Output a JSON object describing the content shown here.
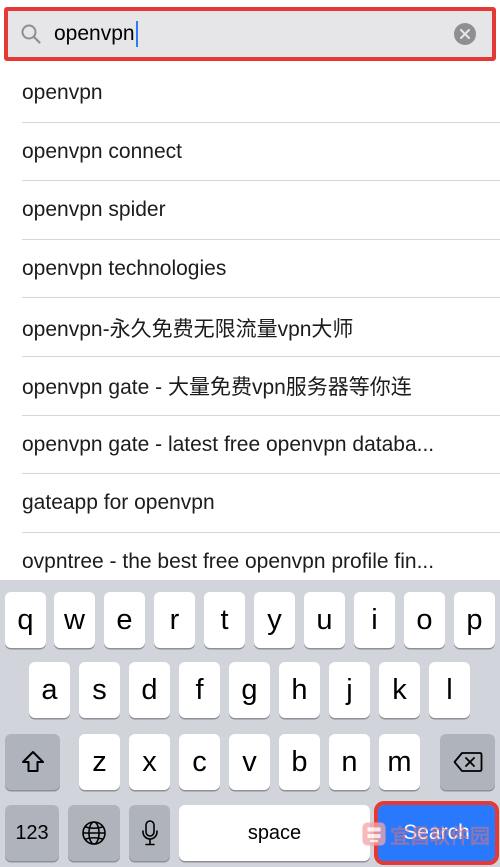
{
  "search": {
    "value": "openvpn"
  },
  "suggestions": [
    "openvpn",
    "openvpn connect",
    "openvpn spider",
    "openvpn technologies",
    "openvpn-永久免费无限流量vpn大师",
    "openvpn gate - 大量免费vpn服务器等你连",
    "openvpn gate - latest free openvpn databa...",
    "gateapp for openvpn",
    "ovpntree - the best free openvpn profile fin..."
  ],
  "keyboard": {
    "row1": [
      "q",
      "w",
      "e",
      "r",
      "t",
      "y",
      "u",
      "i",
      "o",
      "p"
    ],
    "row2": [
      "a",
      "s",
      "d",
      "f",
      "g",
      "h",
      "j",
      "k",
      "l"
    ],
    "row3": [
      "z",
      "x",
      "c",
      "v",
      "b",
      "n",
      "m"
    ],
    "numbers_label": "123",
    "space_label": "space",
    "search_label": "Search"
  },
  "colors": {
    "highlight_border": "#e53935",
    "search_key": "#2979ff",
    "keyboard_bg": "#d1d4da",
    "caret": "#2c7cf6"
  },
  "watermark": {
    "text": "宜昌软件园"
  }
}
